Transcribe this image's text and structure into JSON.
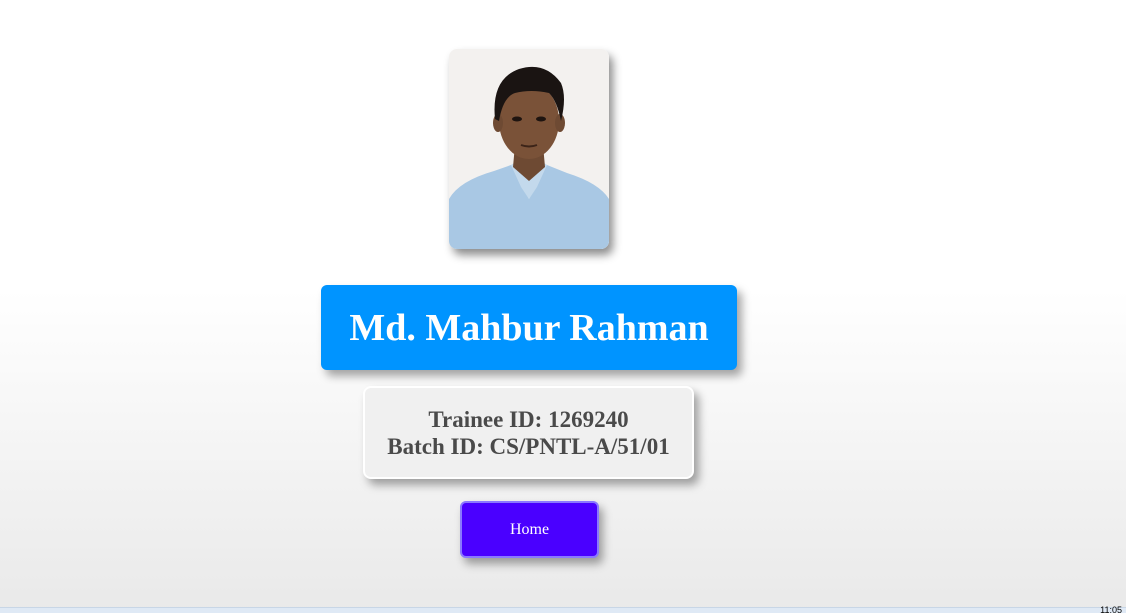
{
  "profile": {
    "photo_alt": "portrait photo",
    "name": "Md. Mahbur Rahman",
    "trainee_id": "Trainee ID: 1269240",
    "batch_id": "Batch ID: CS/PNTL-A/51/01"
  },
  "nav": {
    "home_label": "Home"
  },
  "taskbar": {
    "clock": "11:05"
  },
  "colors": {
    "name_bg": "#0094ff",
    "home_bg": "#4a00ff",
    "info_text": "#4a4a4a"
  }
}
